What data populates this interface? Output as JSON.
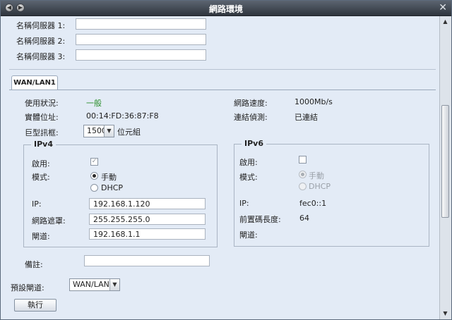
{
  "window": {
    "title": "網路環境"
  },
  "dns": [
    {
      "label": "名稱伺服器 1:",
      "value": ""
    },
    {
      "label": "名稱伺服器 2:",
      "value": ""
    },
    {
      "label": "名稱伺服器 3:",
      "value": ""
    }
  ],
  "tab": {
    "label": "WAN/LAN1"
  },
  "status": {
    "usage_label": "使用狀況:",
    "usage_value": "一般",
    "mac_label": "實體位址:",
    "mac_value": "00:14:FD:36:87:F8",
    "speed_label": "網路速度:",
    "speed_value": "1000Mb/s",
    "link_label": "連結偵測:",
    "link_value": "已連結"
  },
  "jumbo": {
    "label": "巨型訊框:",
    "value": "1500",
    "unit": "位元組"
  },
  "ipv4": {
    "legend": "IPv4",
    "enable_label": "啟用:",
    "enabled": true,
    "mode_label": "模式:",
    "manual_label": "手動",
    "dhcp_label": "DHCP",
    "ip_label": "IP:",
    "ip_value": "192.168.1.120",
    "mask_label": "網路遮罩:",
    "mask_value": "255.255.255.0",
    "gateway_label": "閘道:",
    "gateway_value": "192.168.1.1"
  },
  "ipv6": {
    "legend": "IPv6",
    "enable_label": "啟用:",
    "enabled": false,
    "mode_label": "模式:",
    "manual_label": "手動",
    "dhcp_label": "DHCP",
    "ip_label": "IP:",
    "ip_value": "fec0::1",
    "prefix_label": "前置碼長度:",
    "prefix_value": "64",
    "gateway_label": "閘道:"
  },
  "note": {
    "label": "備註:",
    "value": ""
  },
  "default_gateway": {
    "label": "預設閘道:",
    "value": "WAN/LAN1"
  },
  "actions": {
    "execute_label": "執行"
  }
}
